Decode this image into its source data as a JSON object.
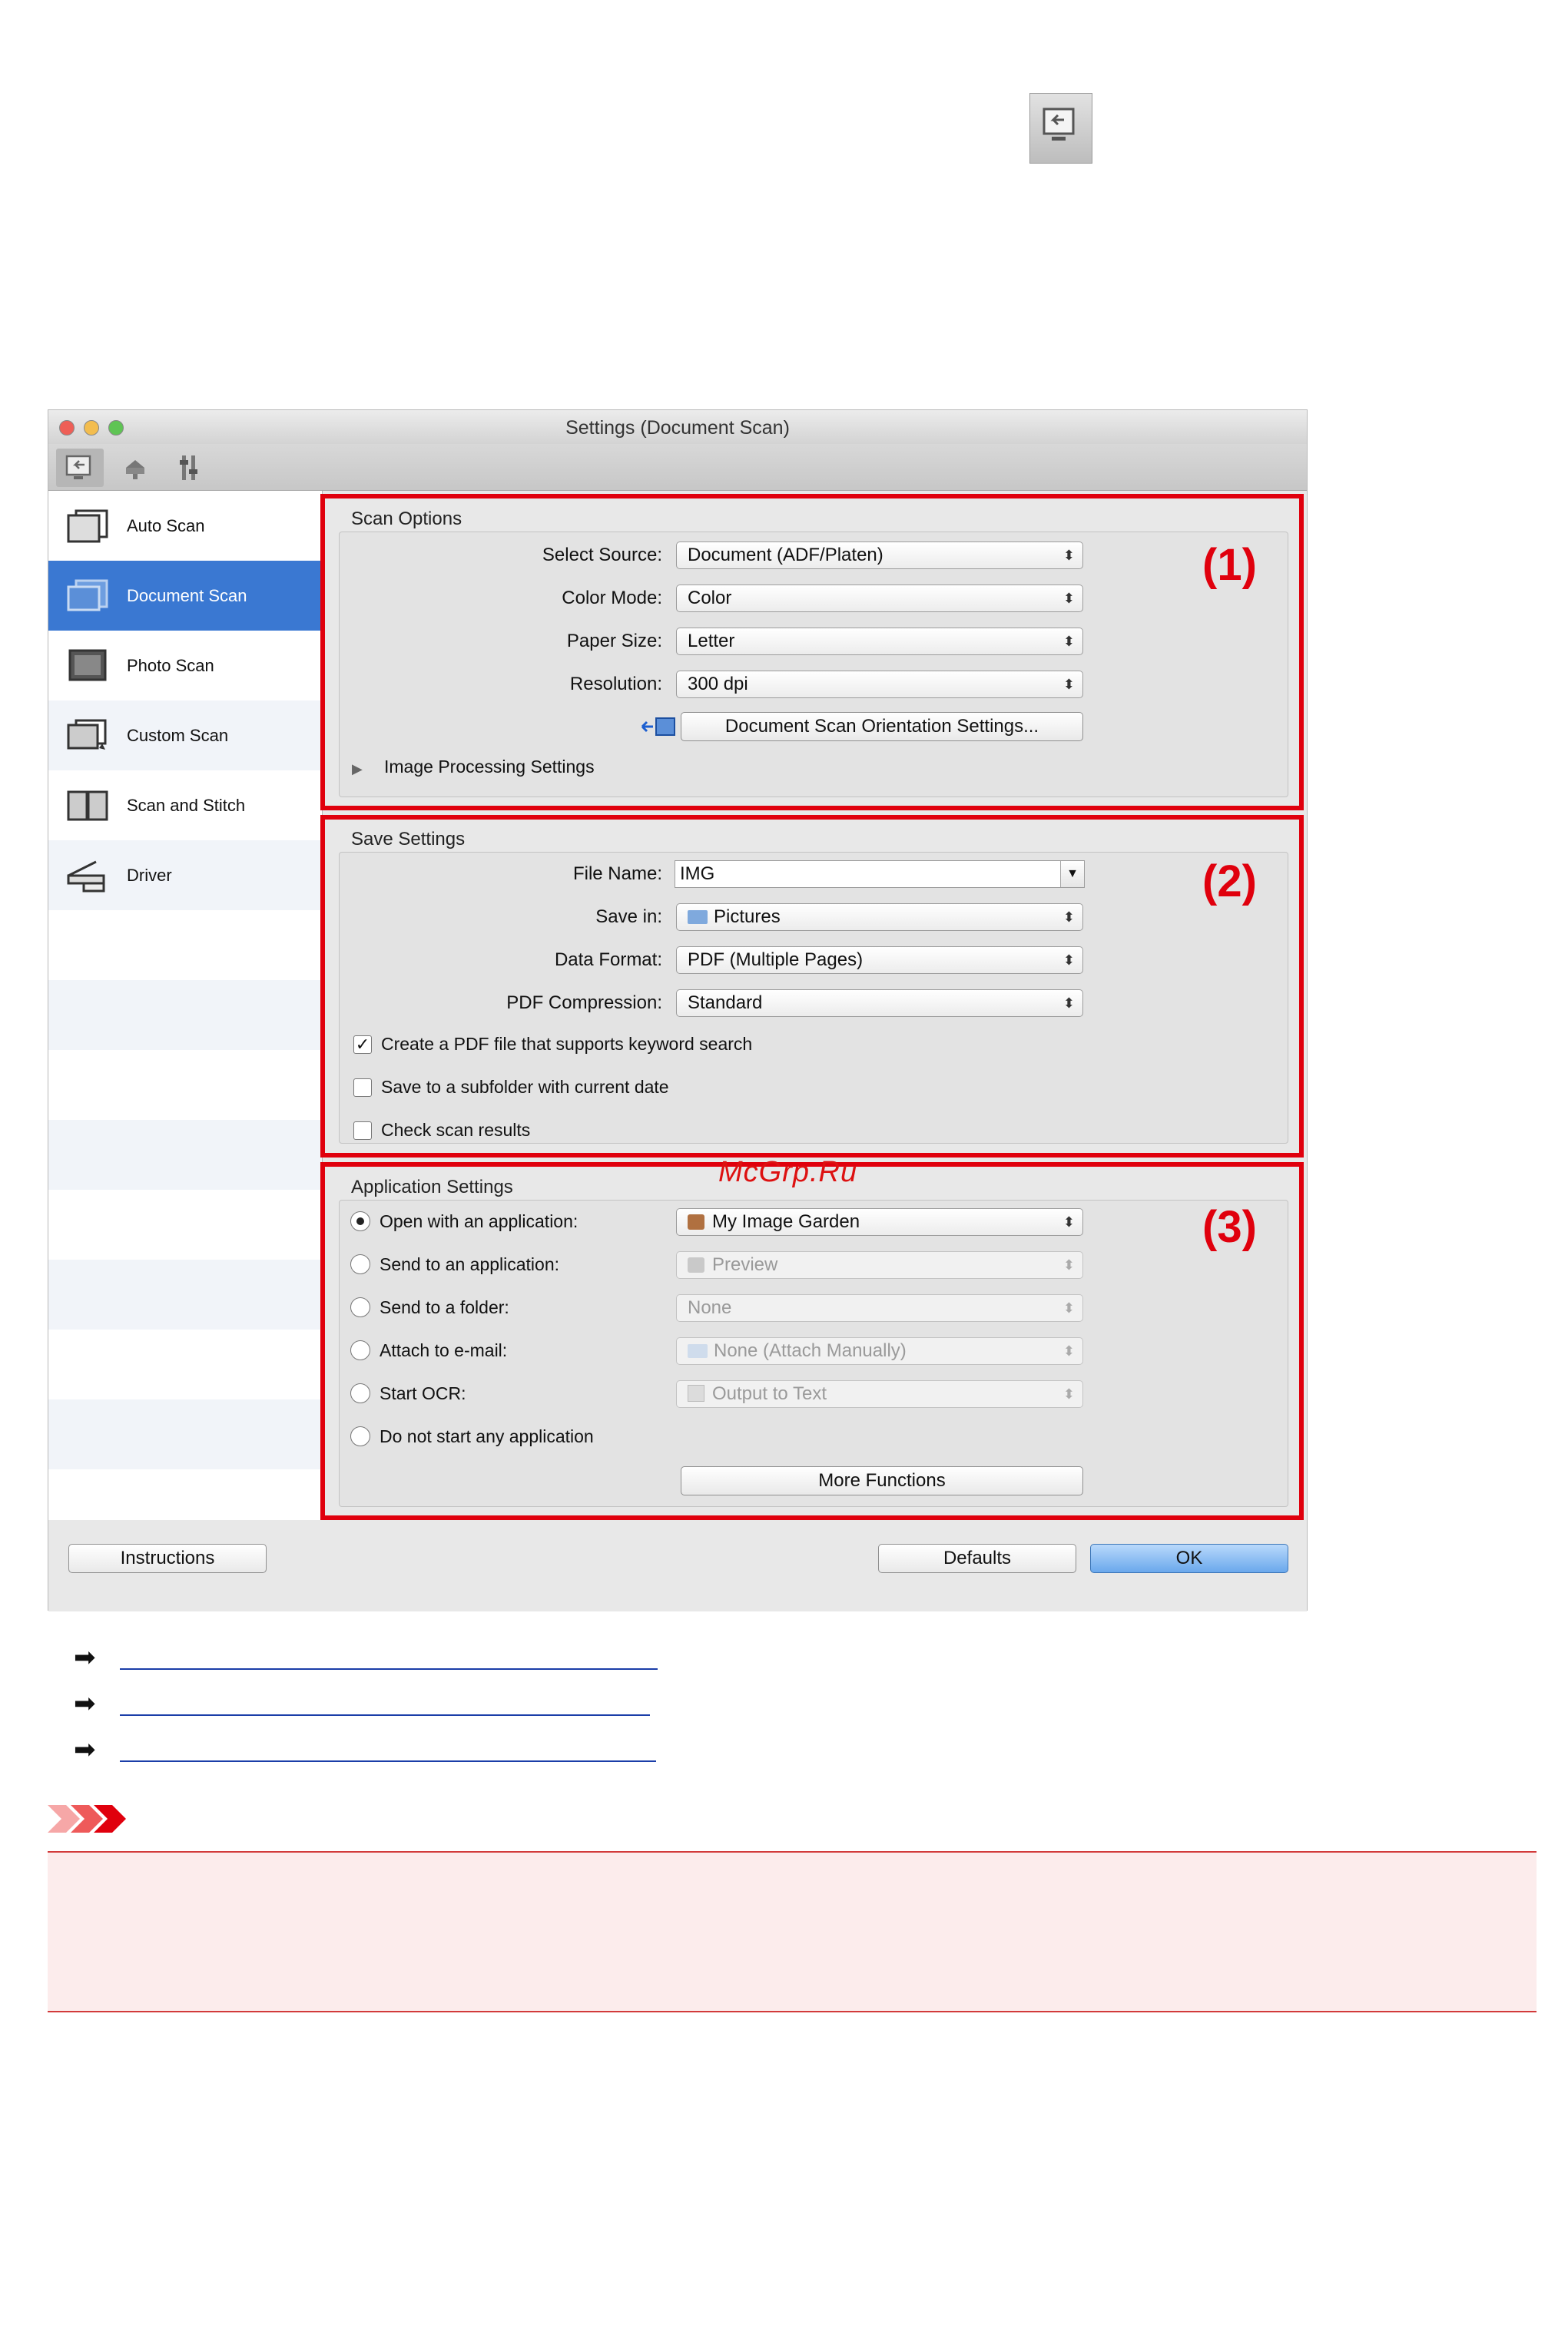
{
  "window": {
    "title": "Settings (Document Scan)"
  },
  "sidebar": {
    "items": [
      {
        "label": "Auto Scan"
      },
      {
        "label": "Document Scan",
        "selected": true
      },
      {
        "label": "Photo Scan"
      },
      {
        "label": "Custom Scan"
      },
      {
        "label": "Scan and Stitch"
      },
      {
        "label": "Driver"
      }
    ]
  },
  "scan_options": {
    "title": "Scan Options",
    "callout": "(1)",
    "select_source_label": "Select Source:",
    "select_source_value": "Document (ADF/Platen)",
    "color_mode_label": "Color Mode:",
    "color_mode_value": "Color",
    "paper_size_label": "Paper Size:",
    "paper_size_value": "Letter",
    "resolution_label": "Resolution:",
    "resolution_value": "300 dpi",
    "orientation_button": "Document Scan Orientation Settings...",
    "image_processing_label": "Image Processing Settings"
  },
  "save_settings": {
    "title": "Save Settings",
    "callout": "(2)",
    "file_name_label": "File Name:",
    "file_name_value": "IMG",
    "save_in_label": "Save in:",
    "save_in_value": "Pictures",
    "data_format_label": "Data Format:",
    "data_format_value": "PDF (Multiple Pages)",
    "pdf_compression_label": "PDF Compression:",
    "pdf_compression_value": "Standard",
    "keyword_search_label": "Create a PDF file that supports keyword search",
    "keyword_search_checked": true,
    "subfolder_label": "Save to a subfolder with current date",
    "subfolder_checked": false,
    "check_results_label": "Check scan results",
    "check_results_checked": false
  },
  "application_settings": {
    "title": "Application Settings",
    "callout": "(3)",
    "options": [
      {
        "label": "Open with an application:",
        "value": "My Image Garden",
        "selected": true,
        "enabled": true
      },
      {
        "label": "Send to an application:",
        "value": "Preview",
        "selected": false,
        "enabled": false
      },
      {
        "label": "Send to a folder:",
        "value": "None",
        "selected": false,
        "enabled": false
      },
      {
        "label": "Attach to e-mail:",
        "value": "None (Attach Manually)",
        "selected": false,
        "enabled": false
      },
      {
        "label": "Start OCR:",
        "value": "Output to Text",
        "selected": false,
        "enabled": false
      },
      {
        "label": "Do not start any application",
        "value": "",
        "selected": false,
        "enabled": true
      }
    ],
    "more_functions_button": "More Functions"
  },
  "buttons": {
    "instructions": "Instructions",
    "defaults": "Defaults",
    "ok": "OK"
  },
  "watermark": "McGrp.Ru",
  "colors": {
    "callout_red": "#e0000d",
    "selection_blue": "#3a78d2",
    "link_blue": "#1a3da8",
    "important_bg": "#fcecec"
  },
  "icons": [
    "screen-scan-icon",
    "scanner-icon",
    "general-settings-icon",
    "folder-icon",
    "image-garden-icon",
    "preview-icon",
    "ocr-icon",
    "orientation-icon",
    "arrow-right-icon",
    "important-icon"
  ]
}
